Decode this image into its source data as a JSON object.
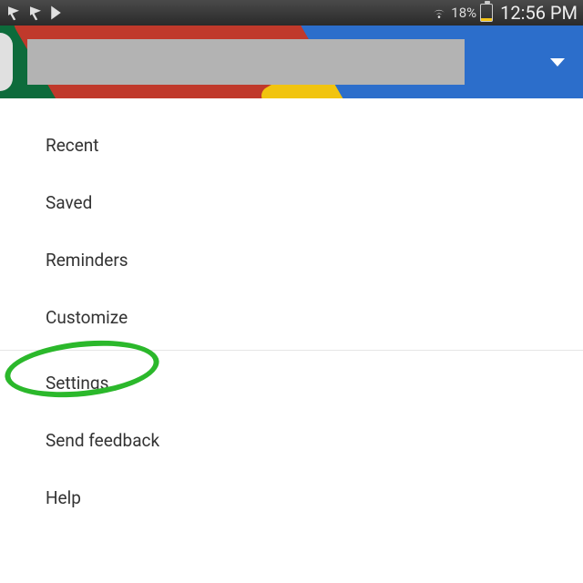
{
  "status": {
    "battery_pct": "18%",
    "time": "12:56 PM"
  },
  "menu": {
    "group1": [
      {
        "label": "Recent"
      },
      {
        "label": "Saved"
      },
      {
        "label": "Reminders"
      },
      {
        "label": "Customize"
      }
    ],
    "group2": [
      {
        "label": "Settings"
      },
      {
        "label": "Send feedback"
      },
      {
        "label": "Help"
      }
    ]
  },
  "annotation": {
    "highlighted_item": "Settings"
  }
}
